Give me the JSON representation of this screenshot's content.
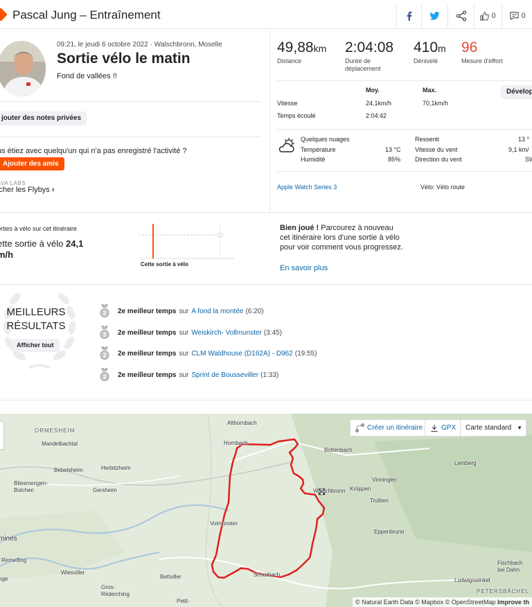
{
  "header": {
    "title": "Pascal Jung – Entraînement",
    "kudos_count": "0",
    "comments_count": "0"
  },
  "activity": {
    "meta": "09:21, le jeudi 6 octobre 2022 · Walschbronn, Moselle",
    "title": "Sortie vélo le matin",
    "description": "Fond de vallées !!",
    "private_notes_btn": "jouter des notes privées",
    "question": "us étiez avec quelqu'un qui n'a pas enregistré l'activité ?",
    "add_friends_btn": "Ajouter des amis",
    "labs_label": "AVA LABS",
    "flybys_link": "icher les Flybys"
  },
  "stats": {
    "distance": {
      "value": "49,88",
      "unit": "km",
      "label": "Distance"
    },
    "moving_time": {
      "value": "2:04:08",
      "label": "Durée de déplacement"
    },
    "elevation": {
      "value": "410",
      "unit": "m",
      "label": "Dénivelé"
    },
    "effort": {
      "value": "96",
      "label": "Mesure d'effort"
    },
    "col_avg": "Moy.",
    "col_max": "Max.",
    "develop_btn": "Développer",
    "speed_label": "Vitesse",
    "speed_avg": "24,1km/h",
    "speed_max": "70,1km/h",
    "elapsed_label": "Temps écoulé",
    "elapsed_value": "2:04:42"
  },
  "weather": {
    "condition": "Quelques nuages",
    "temp_label": "Température",
    "temp_value": "13 °C",
    "humidity_label": "Humidité",
    "humidity_value": "85%",
    "feels_label": "Ressenti",
    "feels_value": "13 °",
    "wind_speed_label": "Vitesse du vent",
    "wind_speed_value": "9,1 km/",
    "wind_dir_label": "Direction du vent",
    "wind_dir_value": "SW"
  },
  "device": {
    "device_link": "Apple Watch Series 3",
    "bike": "Vélo: Vélo route"
  },
  "comparison": {
    "label": "orties à vélo sur cet itinéraire",
    "speed_text": "ette sortie à vélo",
    "speed_value": "24,1",
    "speed_unit": "m/h",
    "chart_label": "Cette sortie à vélo",
    "bravo_bold": "Bien joué !",
    "bravo_text": "Parcourez à nouveau cet itinéraire lors d'une sortie à vélo pour voir comment vous progressez.",
    "learn_more": "En savoir plus"
  },
  "results": {
    "title_line1": "MEILLEURS",
    "title_line2": "RÉSULTATS",
    "show_all_btn": "Afficher tout",
    "items": [
      {
        "rank": "2e meilleur temps",
        "on": "sur",
        "segment": "A fond la montée",
        "time": "(6:20)"
      },
      {
        "rank": "2e meilleur temps",
        "on": "sur",
        "segment": "Weiskirch- Vollmunster",
        "time": "(3:45)"
      },
      {
        "rank": "2e meilleur temps",
        "on": "sur",
        "segment": "CLM Waldhouse (D162A) - D962",
        "time": "(19:55)"
      },
      {
        "rank": "2e meilleur temps",
        "on": "sur",
        "segment": "Sprint de Bousseviller",
        "time": "(1:33)"
      }
    ]
  },
  "map": {
    "create_route": "Créer un itinéraire",
    "gpx": "GPX",
    "map_type": "Carte standard",
    "attribution": "© Natural Earth Data © Mapbox © OpenStreetMap",
    "improve": "Improve th",
    "places": {
      "ormesheim": "ORMESHEIM",
      "mandelbachtal": "Mandelbachtal",
      "bebelsheim": "Bebelsheim",
      "herbitzheim": "Herbitzheim",
      "bliesmengen": "Bliesmengen-Bolchen",
      "gersheim": "Gersheim",
      "althornbach": "Althornbach",
      "hornbach": "Hornbach",
      "bottenbach": "Bottenbach",
      "lemberg": "Lemberg",
      "vinningen": "Vinningen",
      "kroppen": "Kröppen",
      "walschbronn": "Walschbronn",
      "trulben": "Trulben",
      "eppenbrunn": "Eppenbrunn",
      "volmunster": "Volmunster",
      "mines": "mines",
      "remelfing": "Remelfing",
      "wiesviller": "Wiesviller",
      "bettviller": "Bettviller",
      "gros_rederching": "Gros-Réderching",
      "schorbach": "Schorbach",
      "fischbach": "Fischbach bei Dahn",
      "ludwigswinkel": "Ludwigswinkel",
      "petersbachel": "PETERSBÄCHEL",
      "petit": "Petit-",
      "nge": "nge"
    }
  },
  "colors": {
    "brand": "#fc5200",
    "link": "#0a66a8",
    "effort": "#e34a33",
    "route": "#e01e1e"
  }
}
